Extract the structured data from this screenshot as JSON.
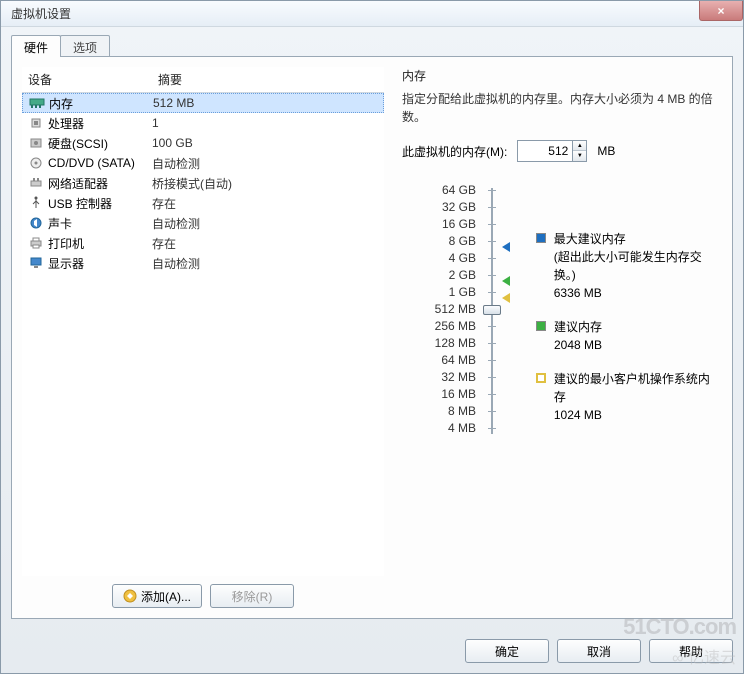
{
  "window": {
    "title": "虚拟机设置",
    "close": "×"
  },
  "tabs": {
    "hw": "硬件",
    "opt": "选项"
  },
  "list": {
    "h_device": "设备",
    "h_summary": "摘要",
    "items": [
      {
        "name": "内存",
        "summary": "512 MB",
        "icon": "memory"
      },
      {
        "name": "处理器",
        "summary": "1",
        "icon": "cpu"
      },
      {
        "name": "硬盘(SCSI)",
        "summary": "100 GB",
        "icon": "disk"
      },
      {
        "name": "CD/DVD (SATA)",
        "summary": "自动检测",
        "icon": "cd"
      },
      {
        "name": "网络适配器",
        "summary": "桥接模式(自动)",
        "icon": "net"
      },
      {
        "name": "USB 控制器",
        "summary": "存在",
        "icon": "usb"
      },
      {
        "name": "声卡",
        "summary": "自动检测",
        "icon": "sound"
      },
      {
        "name": "打印机",
        "summary": "存在",
        "icon": "printer"
      },
      {
        "name": "显示器",
        "summary": "自动检测",
        "icon": "display"
      }
    ]
  },
  "buttons": {
    "add": "添加(A)...",
    "remove": "移除(R)",
    "ok": "确定",
    "cancel": "取消",
    "help": "帮助"
  },
  "mem": {
    "section": "内存",
    "desc": "指定分配给此虚拟机的内存里。内存大小必须为 4 MB 的倍数。",
    "label": "此虚拟机的内存(M):",
    "value": "512",
    "unit": "MB",
    "ticks": [
      "64 GB",
      "32 GB",
      "16 GB",
      "8 GB",
      "4 GB",
      "2 GB",
      "1 GB",
      "512 MB",
      "256 MB",
      "128 MB",
      "64 MB",
      "32 MB",
      "16 MB",
      "8 MB",
      "4 MB"
    ],
    "legend1_title": "最大建议内存",
    "legend1_note": "(超出此大小可能发生内存交换。)",
    "legend1_val": "6336 MB",
    "legend2_title": "建议内存",
    "legend2_val": "2048 MB",
    "legend3_title": "建议的最小客户机操作系统内存",
    "legend3_val": "1024 MB"
  },
  "colors": {
    "blue": "#1e6fc0",
    "green": "#3cb043",
    "yellow": "#e0c040"
  },
  "wm1": "51CTO.com",
  "wm2": "∞ 亿速云"
}
